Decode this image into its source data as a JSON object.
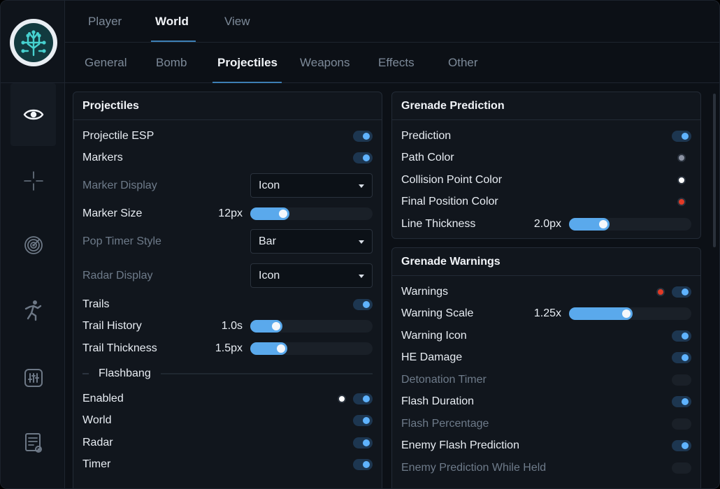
{
  "colors": {
    "accent": "#5aa9ec",
    "toggle_on": "#5fb3ff",
    "red_dot": "#e23a26",
    "white_dot": "#ffffff",
    "grey_dot": "#8c93a3"
  },
  "sidebar": {
    "logo": "circuit-tree-logo",
    "items": [
      {
        "icon": "eye-icon",
        "active": true
      },
      {
        "icon": "crosshair-icon",
        "active": false
      },
      {
        "icon": "radar-icon",
        "active": false
      },
      {
        "icon": "running-figure-icon",
        "active": false
      },
      {
        "icon": "sliders-icon",
        "active": false
      },
      {
        "icon": "config-list-icon",
        "active": false
      }
    ]
  },
  "topnav": {
    "tabs": [
      "Player",
      "World",
      "View"
    ],
    "active": "World"
  },
  "subnav": {
    "tabs": [
      "General",
      "Bomb",
      "Projectiles",
      "Weapons",
      "Effects",
      "Other"
    ],
    "active": "Projectiles"
  },
  "projectiles": {
    "title": "Projectiles",
    "projectile_esp": {
      "label": "Projectile ESP",
      "on": true
    },
    "markers": {
      "label": "Markers",
      "on": true
    },
    "marker_display": {
      "label": "Marker Display",
      "value": "Icon"
    },
    "marker_size": {
      "label": "Marker Size",
      "value": "12px",
      "fill": 0.32
    },
    "pop_timer_style": {
      "label": "Pop Timer Style",
      "value": "Bar"
    },
    "radar_display": {
      "label": "Radar Display",
      "value": "Icon"
    },
    "trails": {
      "label": "Trails",
      "on": true
    },
    "trail_history": {
      "label": "Trail History",
      "value": "1.0s",
      "fill": 0.26
    },
    "trail_thickness": {
      "label": "Trail Thickness",
      "value": "1.5px",
      "fill": 0.3
    },
    "flashbang_section": "Flashbang",
    "enabled": {
      "label": "Enabled",
      "on": true,
      "color": "#ffffff"
    },
    "world": {
      "label": "World",
      "on": true
    },
    "radar": {
      "label": "Radar",
      "on": true
    },
    "timer": {
      "label": "Timer",
      "on": true
    }
  },
  "grenade_prediction": {
    "title": "Grenade Prediction",
    "prediction": {
      "label": "Prediction",
      "on": true
    },
    "path_color": {
      "label": "Path Color",
      "color": "#8c93a3"
    },
    "collision_point_color": {
      "label": "Collision Point Color",
      "color": "#ffffff"
    },
    "final_position_color": {
      "label": "Final Position Color",
      "color": "#e23a26"
    },
    "line_thickness": {
      "label": "Line Thickness",
      "value": "2.0px",
      "fill": 0.33
    }
  },
  "grenade_warnings": {
    "title": "Grenade Warnings",
    "warnings": {
      "label": "Warnings",
      "on": true,
      "color": "#e23a26"
    },
    "warning_scale": {
      "label": "Warning Scale",
      "value": "1.25x",
      "fill": 0.52
    },
    "warning_icon": {
      "label": "Warning Icon",
      "on": true
    },
    "he_damage": {
      "label": "HE Damage",
      "on": true
    },
    "detonation_timer": {
      "label": "Detonation Timer",
      "on": false
    },
    "flash_duration": {
      "label": "Flash Duration",
      "on": true
    },
    "flash_percentage": {
      "label": "Flash Percentage",
      "on": false
    },
    "enemy_flash_prediction": {
      "label": "Enemy Flash Prediction",
      "on": true
    },
    "enemy_prediction_while_held": {
      "label": "Enemy Prediction While Held",
      "on": false
    }
  }
}
